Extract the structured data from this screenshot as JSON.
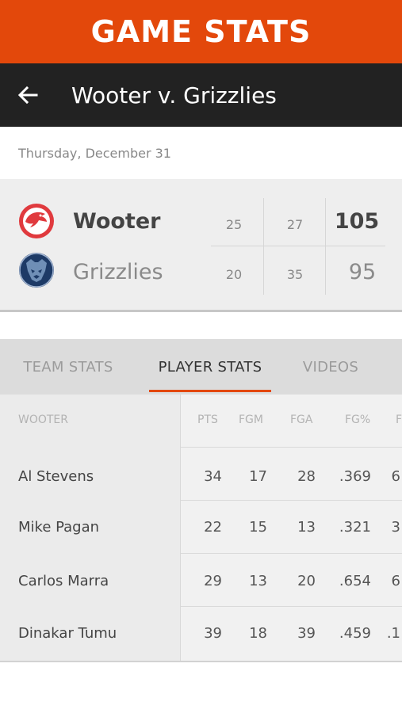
{
  "banner": {
    "title": "GAME STATS"
  },
  "appbar": {
    "back_icon": "arrow-left-icon",
    "title": "Wooter v. Grizzlies"
  },
  "date": "Thursday, December 31",
  "score": {
    "teams": [
      {
        "name": "Wooter",
        "logo_icon": "hawks-logo-icon",
        "q1": "25",
        "q2": "27",
        "total": "105",
        "winner": true
      },
      {
        "name": "Grizzlies",
        "logo_icon": "grizzlies-logo-icon",
        "q1": "20",
        "q2": "35",
        "total": "95",
        "winner": false
      }
    ]
  },
  "tabs": [
    {
      "label": "TEAM STATS",
      "active": false
    },
    {
      "label": "PLAYER STATS",
      "active": true
    },
    {
      "label": "VIDEOS",
      "active": false
    }
  ],
  "player_stats": {
    "team_label": "WOOTER",
    "columns": [
      "PTS",
      "FGM",
      "FGA",
      "FG%",
      "F"
    ],
    "rows": [
      {
        "name": "Al Stevens",
        "values": [
          "34",
          "17",
          "28",
          ".369",
          "6"
        ]
      },
      {
        "name": "Mike Pagan",
        "values": [
          "22",
          "15",
          "13",
          ".321",
          "3"
        ]
      },
      {
        "name": "Carlos Marra",
        "values": [
          "29",
          "13",
          "20",
          ".654",
          "6"
        ]
      },
      {
        "name": "Dinakar Tumu",
        "values": [
          "39",
          "18",
          "39",
          ".459",
          ".1"
        ]
      }
    ]
  },
  "colors": {
    "accent": "#e3480b",
    "appbar": "#222222"
  }
}
